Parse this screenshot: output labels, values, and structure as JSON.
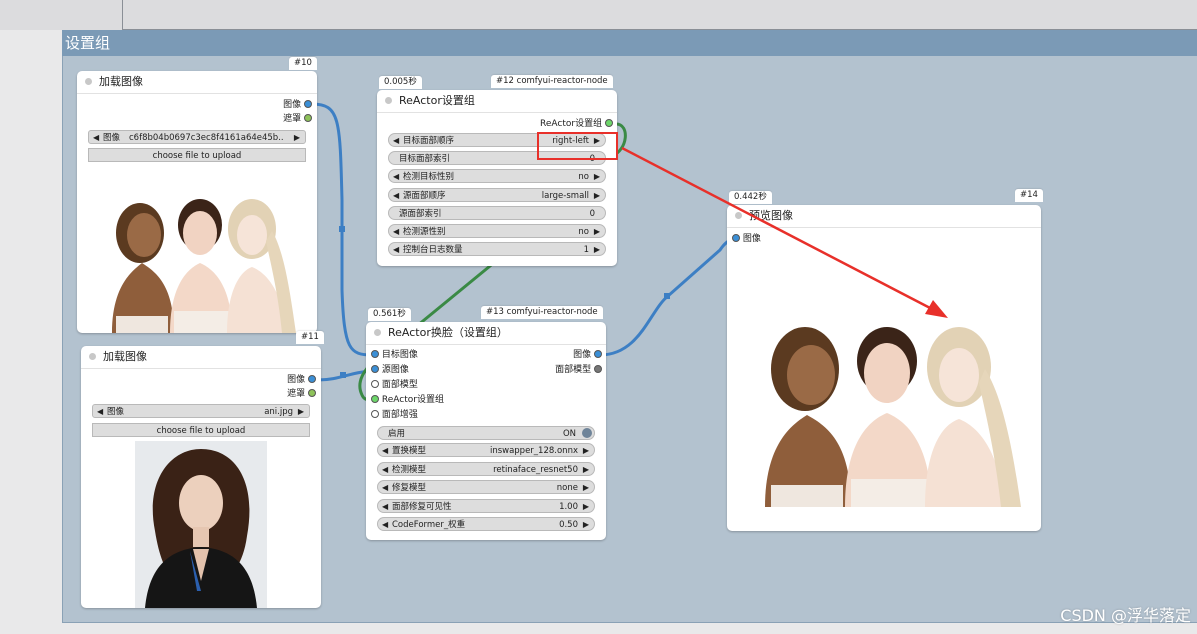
{
  "group": {
    "title": "设置组"
  },
  "load1": {
    "id": "#10",
    "title": "加载图像",
    "outputs": [
      "图像",
      "遮罩"
    ],
    "image_label": "图像",
    "image_value": "c6f8b04b0697c3ec8f4161a64e45b...",
    "upload": "choose file to upload"
  },
  "load2": {
    "id": "#11",
    "title": "加载图像",
    "outputs": [
      "图像",
      "遮罩"
    ],
    "image_label": "图像",
    "image_value": "ani.jpg",
    "upload": "choose file to upload"
  },
  "options": {
    "time": "0.005秒",
    "id": "#12 comfyui-reactor-node",
    "title": "ReActor设置组",
    "output": "ReActor设置组",
    "widgets": [
      {
        "label": "目标面部顺序",
        "value": "right-left",
        "type": "combo"
      },
      {
        "label": "目标面部索引",
        "value": "0",
        "type": "plain"
      },
      {
        "label": "检测目标性别",
        "value": "no",
        "type": "combo"
      },
      {
        "label": "源面部顺序",
        "value": "large-small",
        "type": "combo"
      },
      {
        "label": "源面部索引",
        "value": "0",
        "type": "plain"
      },
      {
        "label": "检测源性别",
        "value": "no",
        "type": "combo"
      },
      {
        "label": "控制台日志数量",
        "value": "1",
        "type": "combo"
      }
    ]
  },
  "swap": {
    "time": "0.561秒",
    "id": "#13 comfyui-reactor-node",
    "title": "ReActor换脸（设置组）",
    "inputs": [
      "目标图像",
      "源图像",
      "面部模型",
      "ReActor设置组",
      "面部增强"
    ],
    "outputs": [
      "图像",
      "面部模型"
    ],
    "enable_label": "启用",
    "enable_value": "ON",
    "widgets": [
      {
        "label": "置换模型",
        "value": "inswapper_128.onnx"
      },
      {
        "label": "检测模型",
        "value": "retinaface_resnet50"
      },
      {
        "label": "修复模型",
        "value": "none"
      },
      {
        "label": "面部修复可见性",
        "value": "1.00"
      },
      {
        "label": "CodeFormer_权重",
        "value": "0.50"
      }
    ]
  },
  "preview": {
    "time": "0.442秒",
    "id": "#14",
    "title": "预览图像",
    "input": "图像"
  },
  "watermark": "CSDN @浮华落定",
  "colors": {
    "image_port": "#3b8fd6",
    "mask_port": "#8ec25a",
    "options_port": "#6dd66a",
    "wire_image": "#3d7fc4",
    "wire_options": "#3a8a45",
    "annotation": "#e8302a"
  },
  "images": {
    "group_photo": "three-women-portrait",
    "single_photo": "woman-dark-hair-portrait",
    "result_photo": "three-women-portrait-swapped"
  }
}
